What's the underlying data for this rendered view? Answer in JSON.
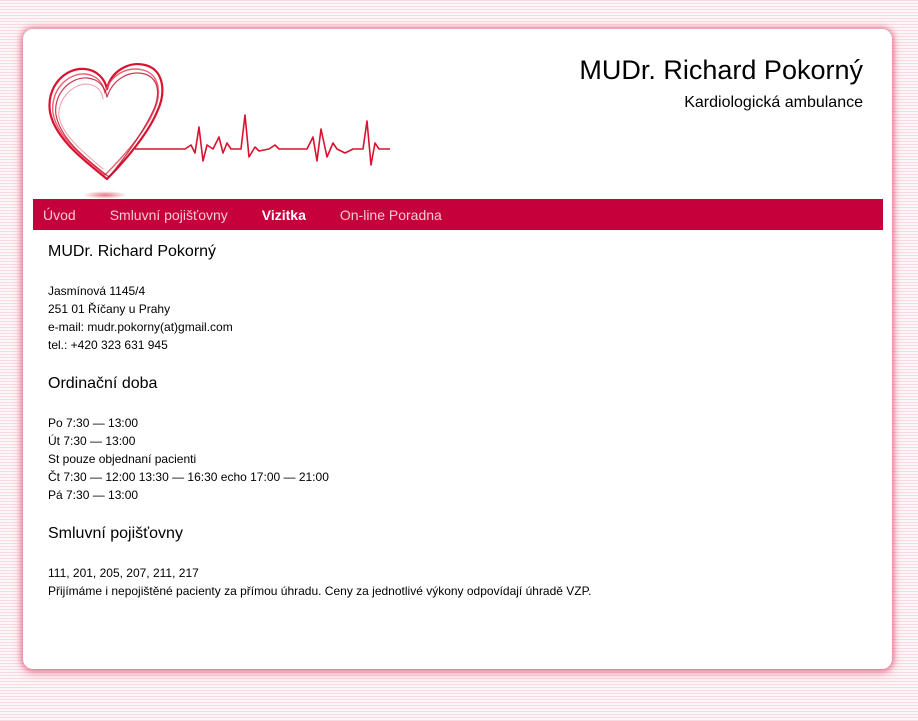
{
  "header": {
    "title": "MUDr. Richard Pokorný",
    "subtitle": "Kardiologická ambulance"
  },
  "nav": {
    "items": [
      {
        "label": "Úvod",
        "active": false
      },
      {
        "label": "Smluvní pojišťovny",
        "active": false
      },
      {
        "label": "Vizitka",
        "active": true
      },
      {
        "label": "On-line Poradna",
        "active": false
      }
    ]
  },
  "content": {
    "contact": {
      "heading": "MUDr. Richard Pokorný",
      "lines": [
        "Jasmínová 1145/4",
        "251 01 Říčany u Prahy",
        "e-mail: mudr.pokorny(at)gmail.com",
        "tel.: +420 323 631 945"
      ]
    },
    "hours": {
      "heading": "Ordinační doba",
      "lines": [
        "Po 7:30 — 13:00",
        "Út 7:30 — 13:00",
        "St pouze objednaní pacienti",
        "Čt 7:30 — 12:00 13:30 — 16:30 echo 17:00 — 21:00",
        "Pá 7:30 — 13:00"
      ]
    },
    "insurance": {
      "heading": "Smluvní pojišťovny",
      "lines": [
        "111, 201, 205, 207, 211, 217",
        "Přijímáme i nepojištěné pacienty za přímou úhradu. Ceny za jednotlivé výkony odpovídají úhradě VZP."
      ]
    }
  },
  "colors": {
    "brand": "#c6003a",
    "nav_text": "#f4cbd6",
    "page_bg": "#fbeef1"
  },
  "icons": {
    "logo": "heart-ecg-logo"
  }
}
